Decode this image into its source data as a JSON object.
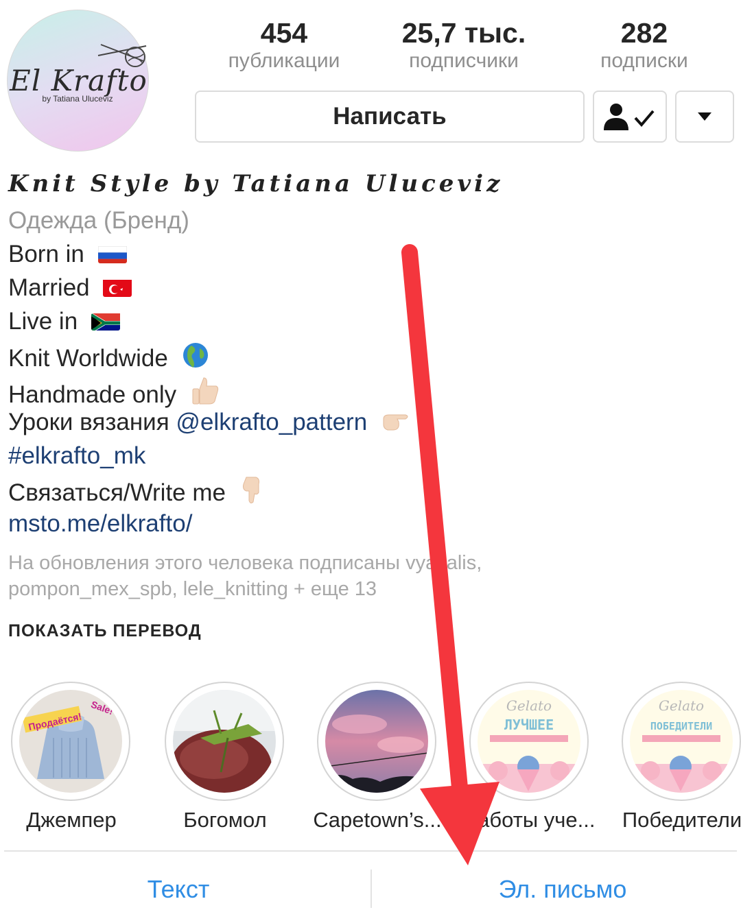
{
  "profile": {
    "logo_text": "El Krafto",
    "logo_subtext": "by Tatiana Uluceviz"
  },
  "stats": [
    {
      "value": "454",
      "label": "публикации"
    },
    {
      "value": "25,7 тыс.",
      "label": "подписчики"
    },
    {
      "value": "282",
      "label": "подписки"
    }
  ],
  "actions": {
    "message_label": "Написать",
    "follow_icon": "person-check-icon",
    "more_icon": "triangle-down-icon"
  },
  "bio": {
    "name": "Knit Style by Tatiana Uluceviz",
    "category": "Одежда (Бренд)",
    "lines": [
      {
        "text": "Born in",
        "emoji": "flag-russia"
      },
      {
        "text": "Married",
        "emoji": "flag-turkey"
      },
      {
        "text": "Live in",
        "emoji": "flag-south-africa"
      },
      {
        "text": "Knit Worldwide",
        "emoji": "globe-icon"
      },
      {
        "text": "Handmade only",
        "emoji": "thumbs-up-icon"
      }
    ],
    "lessons_text": "Уроки вязания",
    "lessons_mention": "@elkrafto_pattern",
    "hashtag": "#elkrafto_mk",
    "contact_text": "Связаться/Write me",
    "website": "msto.me/elkrafto/",
    "followed_by_line1": "На обновления этого человека подписаны vyazalis,",
    "followed_by_line2": "pompon_mex_spb, lele_knitting + еще 13",
    "translate_label": "ПОКАЗАТЬ ПЕРЕВОД"
  },
  "highlights": [
    {
      "label": "Джемпер",
      "overlay_a": "Продаётся!",
      "overlay_b": "Sale!"
    },
    {
      "label": "Богомол"
    },
    {
      "label": "Capetown’s..."
    },
    {
      "label": "Работы уче...",
      "gelato": "Gelato",
      "title": "ЛУЧШЕЕ"
    },
    {
      "label": "Победители",
      "gelato": "Gelato",
      "title": "ПОБЕДИТЕЛИ"
    }
  ],
  "contact_bar": {
    "text_label": "Текст",
    "email_label": "Эл. письмо"
  },
  "colors": {
    "link": "#1d3f73",
    "accent_blue": "#2f8de4",
    "arrow_red": "#f4363d",
    "muted_gray": "#999999"
  }
}
